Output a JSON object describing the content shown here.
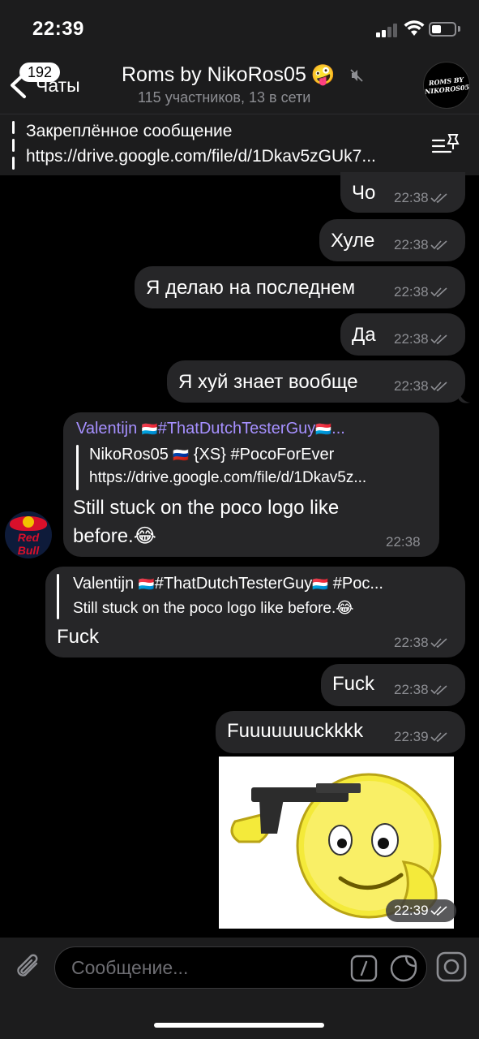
{
  "status_bar": {
    "time": "22:39"
  },
  "header": {
    "back_label": "Чаты",
    "unread_badge": "192",
    "title": "Roms by NikoRos05",
    "title_emoji": "🤪",
    "subtitle": "115 участников, 13 в сети",
    "avatar_text": "ROMS BY NIKOROS05"
  },
  "pinned": {
    "title": "Закреплённое сообщение",
    "text": "https://drive.google.com/file/d/1Dkav5zGUk7..."
  },
  "messages": [
    {
      "text": "Чо",
      "time": "22:38"
    },
    {
      "text": "Хуле",
      "time": "22:38"
    },
    {
      "text": "Я делаю на последнем",
      "time": "22:38"
    },
    {
      "text": "Да",
      "time": "22:38"
    },
    {
      "text": "Я хуй знает вообще",
      "time": "22:38"
    }
  ],
  "incoming": {
    "sender": "Valentijn",
    "sender_tag": "#ThatDutchTesterGuy",
    "flag": "🇱🇺",
    "reply_name": "NikoRos05",
    "reply_flag": "🇷🇺",
    "reply_tag": "{XS} #PocoForEver",
    "reply_text": "https://drive.google.com/file/d/1Dkav5z...",
    "text_line1": "Still stuck on the poco logo like",
    "text_line2": "before.",
    "text_emoji": "😂",
    "time": "22:38",
    "avatar_text": "Red Bull"
  },
  "reply_out": {
    "quote_name": "Valentijn",
    "quote_tag": "#ThatDutchTesterGuy",
    "quote_tag2": "#Poc...",
    "flag": "🇱🇺",
    "quote_text": "Still stuck on the poco logo like before.",
    "quote_emoji": "😂",
    "text": "Fuck",
    "time": "22:38"
  },
  "messages2": [
    {
      "text": "Fuck",
      "time": "22:38"
    },
    {
      "text": "Fuuuuuuuckkkk",
      "time": "22:39"
    }
  ],
  "sticker": {
    "time": "22:39",
    "icon": "gun-smiley-sticker"
  },
  "composer": {
    "placeholder": "Сообщение..."
  },
  "colors": {
    "bubble": "#262628",
    "bar": "#1c1c1d",
    "name_accent": "#a690ff",
    "meta": "#8d8e93"
  }
}
